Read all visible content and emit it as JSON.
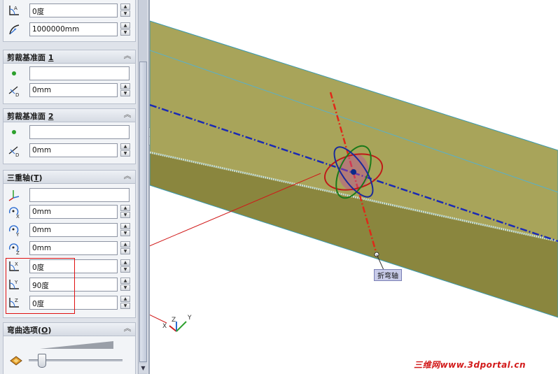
{
  "angle_field_top": "0度",
  "radius_field": "1000000mm",
  "trim_plane_1": {
    "title": "剪裁基准面",
    "hotkey": "1",
    "vertex_value": "",
    "distance_value": "0mm"
  },
  "trim_plane_2": {
    "title": "剪裁基准面",
    "hotkey": "2",
    "vertex_value": "",
    "distance_value": "0mm"
  },
  "triad": {
    "title": "三重轴",
    "hotkey": "T",
    "origin_value": "",
    "x_value": "0mm",
    "y_value": "0mm",
    "z_value": "0mm",
    "rot_x_value": "0度",
    "rot_y_value": "90度",
    "rot_z_value": "0度"
  },
  "bend_options": {
    "title": "弯曲选项",
    "hotkey": "O"
  },
  "viewport": {
    "bend_axis_label": "折弯轴",
    "watermark": "三维网www.3dportal.cn",
    "axis_x": "X",
    "axis_y": "Y",
    "axis_z": "Z"
  },
  "colors": {
    "beam_top": "#a8a45a",
    "beam_front": "#8a863e",
    "axis_line": "#1a2ab4",
    "bend_axis": "#e02818",
    "callout_line": "#d01818"
  }
}
